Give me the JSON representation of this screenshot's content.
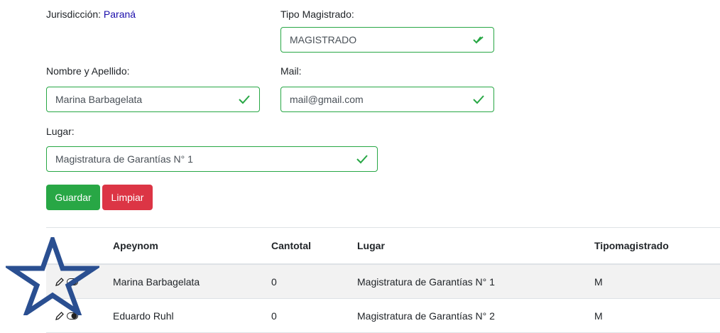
{
  "form": {
    "jurisdiccion_label": "Jurisdicción:",
    "jurisdiccion_value": "Paraná",
    "tipo_label": "Tipo Magistrado:",
    "tipo_value": "MAGISTRADO",
    "nombre_label": "Nombre y Apellido:",
    "nombre_value": "Marina Barbagelata",
    "mail_label": "Mail:",
    "mail_value": "mail@gmail.com",
    "lugar_label": "Lugar:",
    "lugar_value": "Magistratura de Garantías N° 1",
    "save_label": "Guardar",
    "clear_label": "Limpiar"
  },
  "table": {
    "headers": [
      "",
      "Apeynom",
      "Cantotal",
      "Lugar",
      "Tipomagistrado"
    ],
    "rows": [
      {
        "apeynom": "Marina Barbagelata",
        "cantotal": "0",
        "lugar": "Magistratura de Garantías N° 1",
        "tipo": "M"
      },
      {
        "apeynom": "Eduardo Ruhl",
        "cantotal": "0",
        "lugar": "Magistratura de Garantías N° 2",
        "tipo": "M"
      }
    ]
  },
  "colors": {
    "valid": "#28a745",
    "danger": "#dc3545",
    "star": "#2a4f91"
  },
  "icons": [
    "check-icon",
    "pencil-icon",
    "toggle-icon",
    "star-annotation-icon"
  ]
}
